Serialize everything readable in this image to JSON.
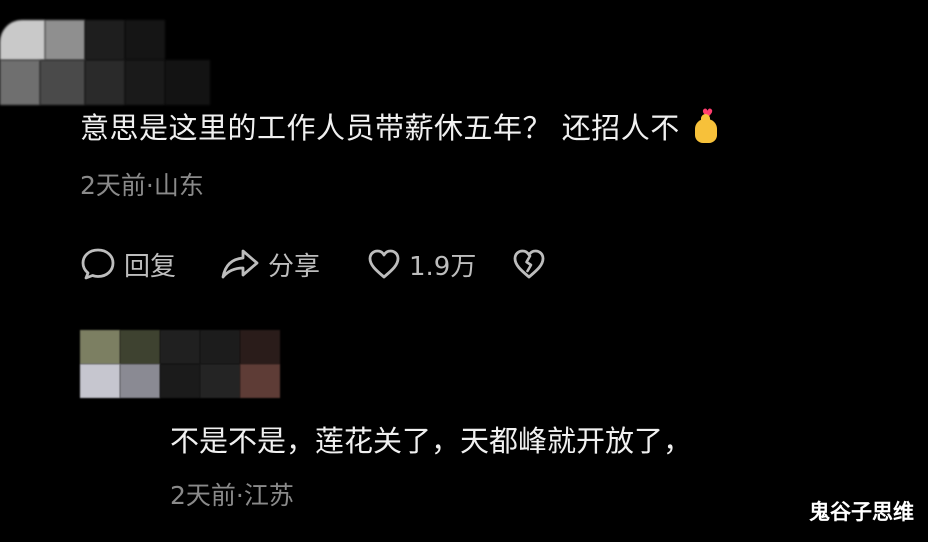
{
  "comments": [
    {
      "text": "意思是这里的工作人员带薪休五年？ 还招人不",
      "emoji": "heart-hand-emoji",
      "meta": "2天前·山东",
      "actions": {
        "reply_label": "回复",
        "share_label": "分享",
        "like_count": "1.9万"
      }
    },
    {
      "text": "不是不是，莲花关了，天都峰就开放了，",
      "meta": "2天前·江苏"
    }
  ],
  "watermark": "鬼谷子思维",
  "icons": {
    "reply": "comment-bubble-icon",
    "share": "share-arrow-icon",
    "like": "heart-outline-icon",
    "dislike": "broken-heart-icon"
  },
  "colors": {
    "background": "#000000",
    "text": "#f0f0f0",
    "meta": "#8a8a8a",
    "action": "#bdbdbd",
    "emoji_heart": "#ff3d6e",
    "emoji_hand": "#f7c13a"
  }
}
